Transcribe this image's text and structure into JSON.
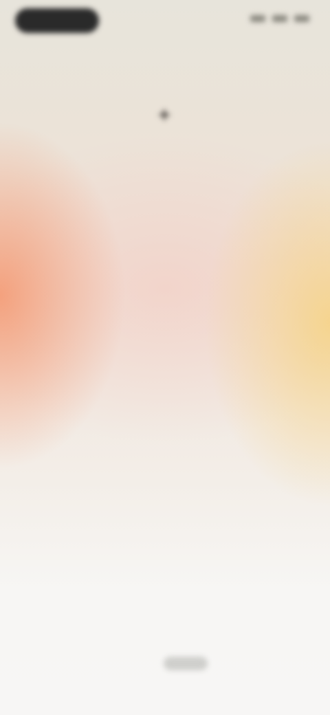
{
  "status_bar": {
    "pill_label": "",
    "icons": [
      "signal-icon",
      "wifi-icon",
      "battery-icon"
    ]
  },
  "page": {
    "icon": "sparkle-icon",
    "title": "",
    "paragraphs": [
      "",
      "",
      "",
      "",
      ""
    ]
  },
  "bottom": {
    "button_label": ""
  },
  "colors": {
    "accent_left": "#f4966e",
    "accent_right": "#f6d282",
    "text": "#2e2a28",
    "pill": "#2a2a2a"
  }
}
